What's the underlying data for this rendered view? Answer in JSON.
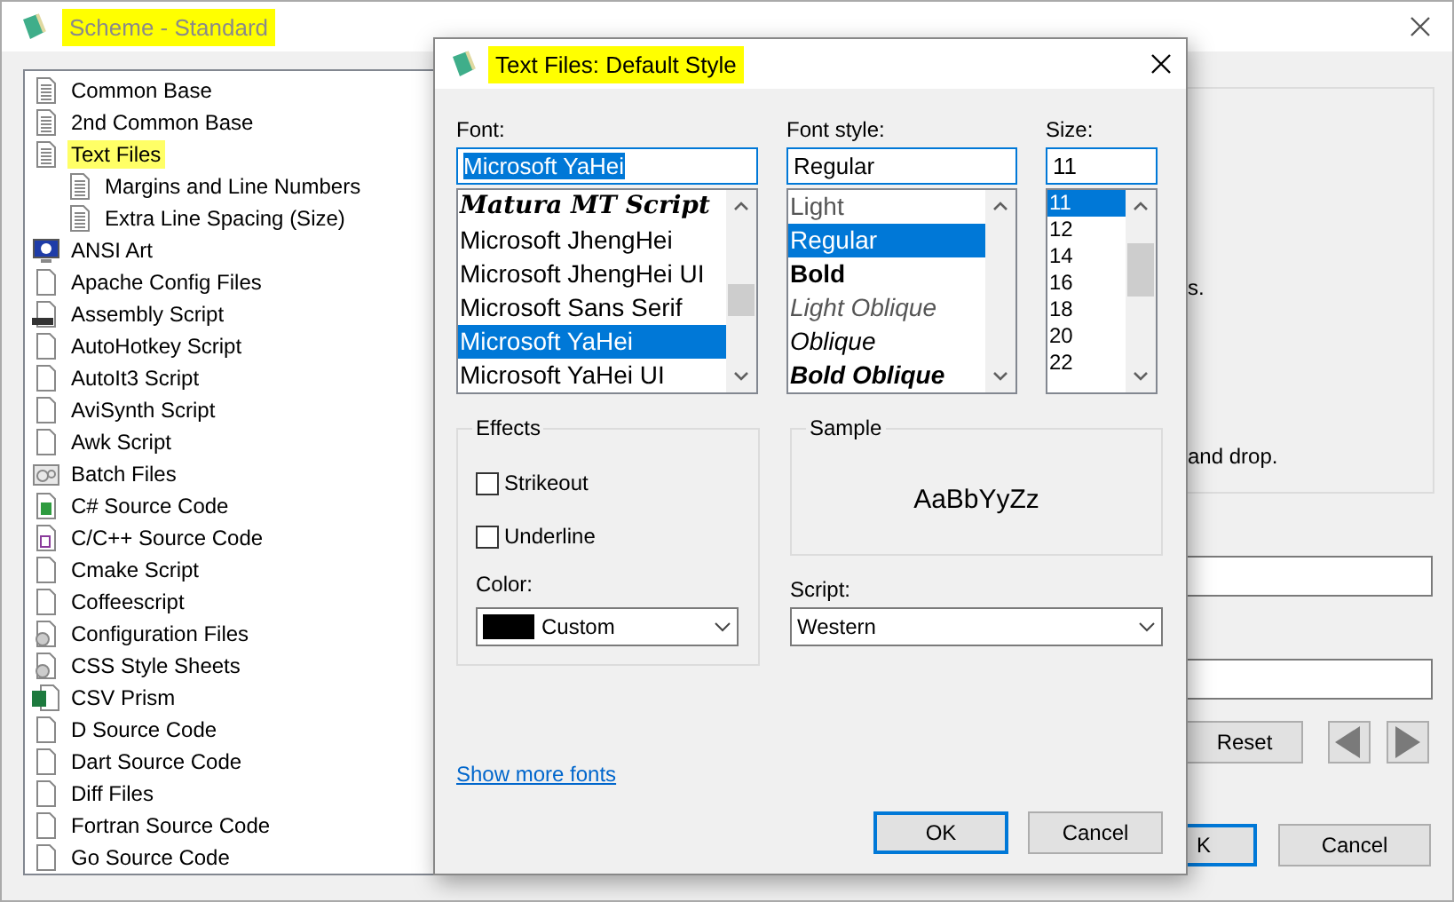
{
  "window": {
    "title": "Scheme - Standard",
    "title_highlighted": true
  },
  "scheme_tree": [
    {
      "label": "Common Base",
      "kind": "lined",
      "highlighted": false
    },
    {
      "label": "2nd Common Base",
      "kind": "lined",
      "highlighted": false
    },
    {
      "label": "Text Files",
      "kind": "lined",
      "highlighted": true,
      "children": [
        {
          "label": "Margins and Line Numbers",
          "kind": "lined",
          "highlighted": false
        },
        {
          "label": "Extra Line Spacing (Size)",
          "kind": "lined",
          "highlighted": false
        }
      ]
    },
    {
      "label": "ANSI Art",
      "kind": "monitor",
      "highlighted": false
    },
    {
      "label": "Apache Config Files",
      "kind": "blank",
      "highlighted": false
    },
    {
      "label": "Assembly Script",
      "kind": "asm",
      "highlighted": false
    },
    {
      "label": "AutoHotkey Script",
      "kind": "blank",
      "highlighted": false
    },
    {
      "label": "AutoIt3 Script",
      "kind": "blank",
      "highlighted": false
    },
    {
      "label": "AviSynth Script",
      "kind": "blank",
      "highlighted": false
    },
    {
      "label": "Awk Script",
      "kind": "blank",
      "highlighted": false
    },
    {
      "label": "Batch Files",
      "kind": "gears",
      "highlighted": false
    },
    {
      "label": "C# Source Code",
      "kind": "green",
      "highlighted": false
    },
    {
      "label": "C/C++ Source Code",
      "kind": "purple",
      "highlighted": false
    },
    {
      "label": "Cmake Script",
      "kind": "blank",
      "highlighted": false
    },
    {
      "label": "Coffeescript",
      "kind": "blank",
      "highlighted": false
    },
    {
      "label": "Configuration Files",
      "kind": "gear",
      "highlighted": false
    },
    {
      "label": "CSS Style Sheets",
      "kind": "gear",
      "highlighted": false
    },
    {
      "label": "CSV Prism",
      "kind": "sheet",
      "highlighted": false
    },
    {
      "label": "D Source Code",
      "kind": "blank",
      "highlighted": false
    },
    {
      "label": "Dart Source Code",
      "kind": "blank",
      "highlighted": false
    },
    {
      "label": "Diff Files",
      "kind": "blank",
      "highlighted": false
    },
    {
      "label": "Fortran Source Code",
      "kind": "blank",
      "highlighted": false
    },
    {
      "label": "Go Source Code",
      "kind": "blank",
      "highlighted": false
    }
  ],
  "description_fragments": [
    "s.",
    "and drop."
  ],
  "reset_button": "Reset",
  "footer_buttons": [
    {
      "label": "K",
      "default": true
    },
    {
      "label": "Cancel",
      "default": false
    }
  ],
  "dialog": {
    "title": "Text Files: Default Style",
    "title_highlighted": true,
    "font": {
      "label": "Font:",
      "value": "Microsoft YaHei",
      "value_selected": true,
      "options": [
        {
          "label": "Matura MT Script",
          "kind": "script",
          "selected": false
        },
        {
          "label": "Microsoft JhengHei",
          "kind": "sans",
          "selected": false
        },
        {
          "label": "Microsoft JhengHei UI",
          "kind": "sans",
          "selected": false
        },
        {
          "label": "Microsoft Sans Serif",
          "kind": "sans",
          "selected": false
        },
        {
          "label": "Microsoft YaHei",
          "kind": "sans",
          "selected": true
        },
        {
          "label": "Microsoft YaHei UI",
          "kind": "sans",
          "selected": false
        }
      ]
    },
    "font_style": {
      "label": "Font style:",
      "value": "Regular",
      "options": [
        {
          "label": "Light",
          "kind": "light",
          "selected": false
        },
        {
          "label": "Regular",
          "kind": "regular",
          "selected": true
        },
        {
          "label": "Bold",
          "kind": "bold",
          "selected": false
        },
        {
          "label": "Light Oblique",
          "kind": "light-oblique",
          "selected": false
        },
        {
          "label": "Oblique",
          "kind": "oblique",
          "selected": false
        },
        {
          "label": "Bold Oblique",
          "kind": "bold-oblique",
          "selected": false
        }
      ]
    },
    "size": {
      "label": "Size:",
      "value": "11",
      "options": [
        {
          "label": "11",
          "selected": true
        },
        {
          "label": "12",
          "selected": false
        },
        {
          "label": "14",
          "selected": false
        },
        {
          "label": "16",
          "selected": false
        },
        {
          "label": "18",
          "selected": false
        },
        {
          "label": "20",
          "selected": false
        },
        {
          "label": "22",
          "selected": false
        }
      ]
    },
    "effects": {
      "label": "Effects",
      "checkboxes": [
        {
          "label": "Strikeout",
          "checked": false
        },
        {
          "label": "Underline",
          "checked": false
        }
      ],
      "color": {
        "label": "Color:",
        "value": "Custom",
        "color": "#000000"
      }
    },
    "sample": {
      "label": "Sample",
      "text": "AaBbYyZz"
    },
    "script": {
      "label": "Script:",
      "value": "Western"
    },
    "link": "Show more fonts",
    "buttons": [
      {
        "label": "OK",
        "default": true
      },
      {
        "label": "Cancel",
        "default": false
      }
    ]
  }
}
